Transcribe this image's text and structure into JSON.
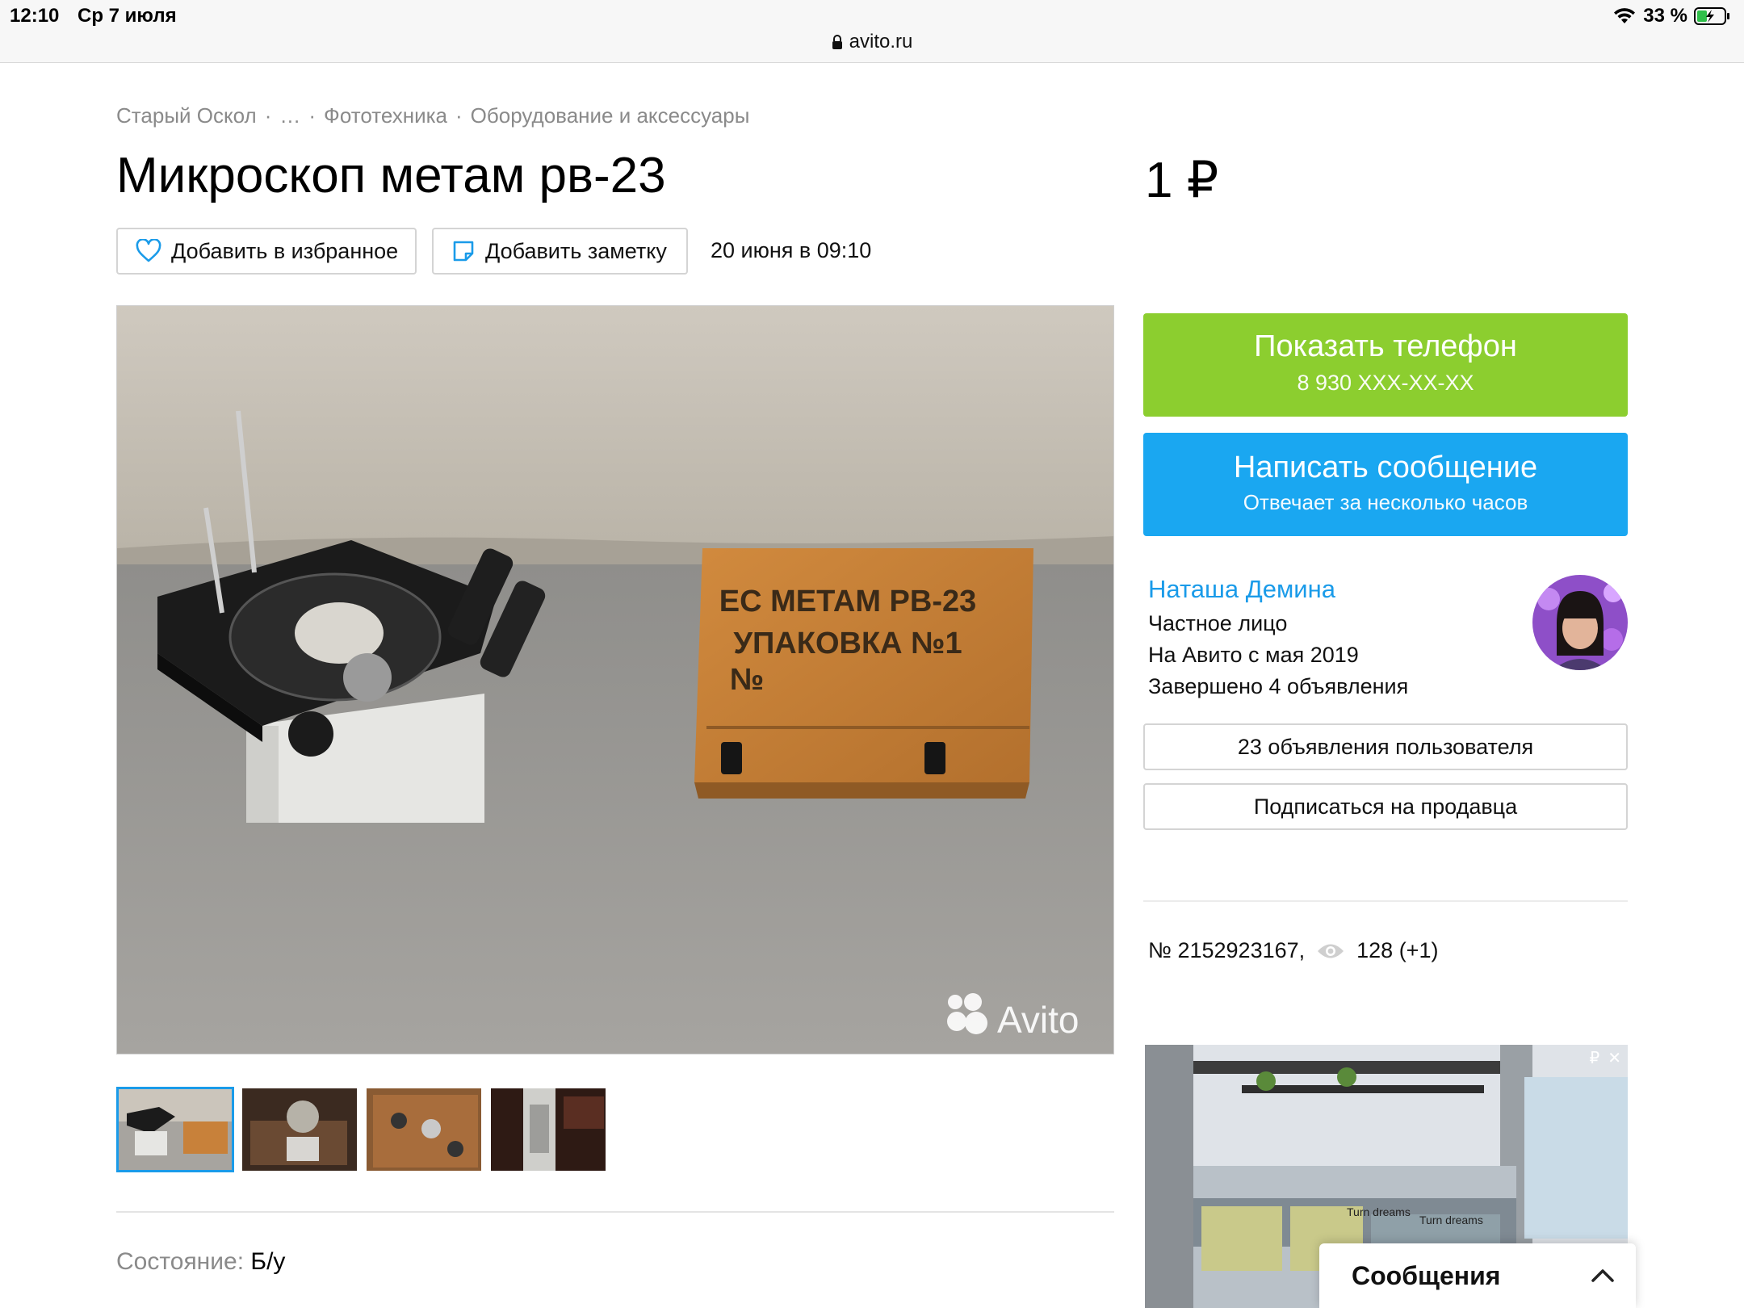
{
  "status_bar": {
    "time": "12:10",
    "date": "Ср 7 июля",
    "battery": "33 %",
    "url": "avito.ru"
  },
  "breadcrumb": [
    "Старый Оскол",
    "…",
    "Фототехника",
    "Оборудование и аксессуары"
  ],
  "listing": {
    "title": "Микроскоп метам рв-23",
    "price": "1 ₽",
    "favorite_label": "Добавить в избранное",
    "note_label": "Добавить заметку",
    "date": "20 июня в 09:10",
    "condition_label": "Состояние:",
    "condition_value": "Б/у",
    "photo_text": {
      "box_line1": "ЕС МЕТАМ РВ-23",
      "box_line2": "УПАКОВКА №1",
      "box_line3": "№",
      "watermark": "Avito"
    }
  },
  "contact": {
    "call_label": "Показать телефон",
    "phone_masked": "8 930 XXX-XX-XX",
    "message_label": "Написать сообщение",
    "message_sub": "Отвечает за несколько часов"
  },
  "seller": {
    "name": "Наташа Демина",
    "type": "Частное лицо",
    "since": "На Авито с мая 2019",
    "completed": "Завершено 4 объявления",
    "ads_button": "23 объявления пользователя",
    "subscribe_button": "Подписаться на продавца"
  },
  "stats": {
    "ad_number": "№ 2152923167,",
    "views": "128 (+1)"
  },
  "ad_banner": {
    "corner_mark": "₽",
    "close_mark": "✕",
    "sign1": "Turn dreams",
    "sign2": "Turn dreams"
  },
  "messages_popup": {
    "label": "Сообщения"
  },
  "colors": {
    "call_green": "#8cce2f",
    "message_blue": "#1aa7f1",
    "link_blue": "#1a9be9"
  }
}
